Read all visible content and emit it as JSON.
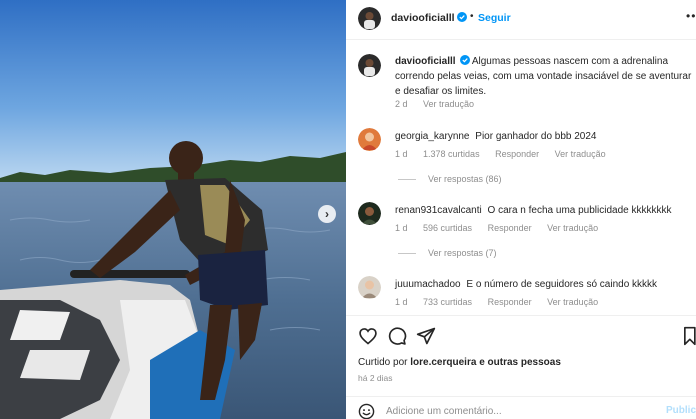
{
  "post": {
    "author": "daviooficialll",
    "follow_label": "Seguir",
    "separator": "•",
    "more_label": "•••",
    "caption_text": "Algumas pessoas nascem com a adrenalina correndo pelas veias, com uma vontade insaciável de se aventurar e desafiar os limites.",
    "caption_age": "2 d",
    "see_translation": "Ver tradução"
  },
  "comments": [
    {
      "user": "georgia_karynne",
      "text": "Pior ganhador do bbb 2024",
      "age": "1 d",
      "likes": "1.378 curtidas",
      "reply": "Responder",
      "translate": "Ver tradução",
      "replies_label": "Ver respostas (86)"
    },
    {
      "user": "renan931cavalcanti",
      "text": "O cara n fecha uma publicidade kkkkkkkk",
      "age": "1 d",
      "likes": "596 curtidas",
      "reply": "Responder",
      "translate": "Ver tradução",
      "replies_label": "Ver respostas (7)"
    },
    {
      "user": "juuumachadoo",
      "text": "E o número de seguidores só caindo kkkkk",
      "age": "1 d",
      "likes": "733 curtidas",
      "reply": "Responder",
      "translate": "Ver tradução"
    }
  ],
  "footer": {
    "liked_prefix": "Curtido por",
    "liked_user": "lore.cerqueira",
    "liked_suffix": "e outras pessoas",
    "time": "há 2 dias",
    "comment_placeholder": "Adicione um comentário...",
    "publish_label": "Publicar"
  },
  "icons": {
    "like": "heart-icon",
    "comment": "comment-bubble-icon",
    "share": "paper-plane-icon",
    "save": "bookmark-icon",
    "emoji": "smiley-icon",
    "verified": "verified-badge-icon",
    "next": "chevron-right-icon"
  },
  "colors": {
    "accent": "#0095f6",
    "muted": "#8e8e8e",
    "verified": "#0095f6"
  }
}
